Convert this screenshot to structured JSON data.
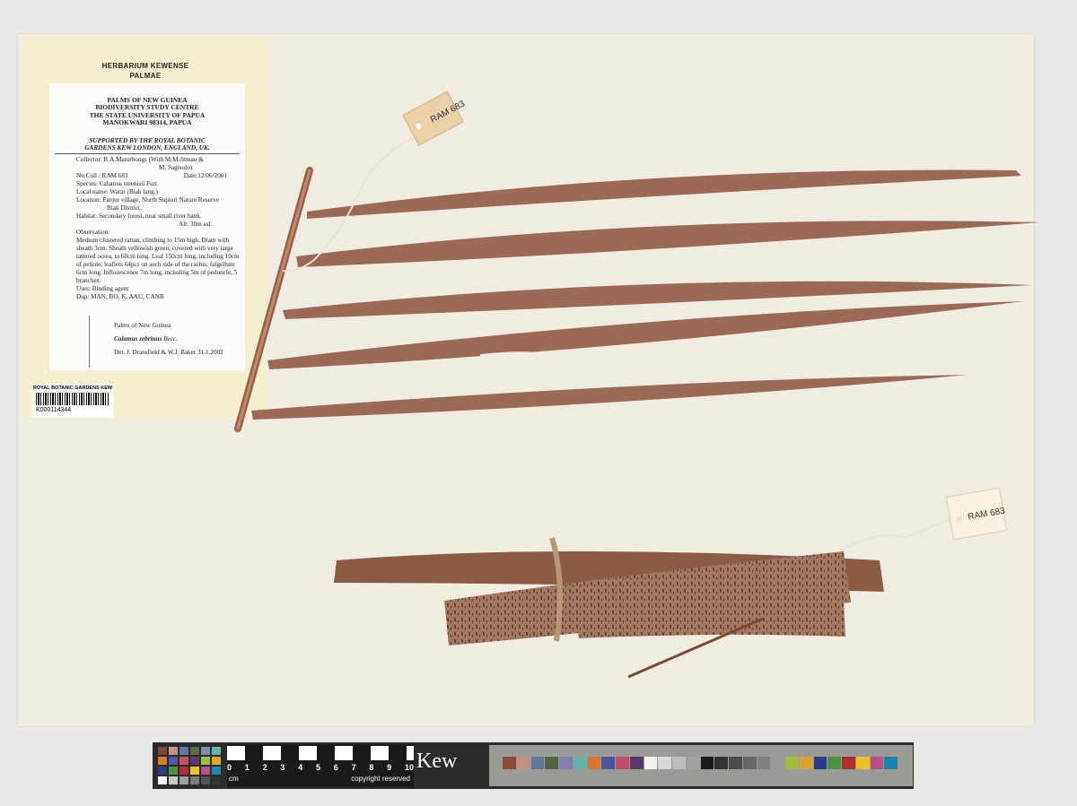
{
  "herbarium": {
    "line1": "HERBARIUM KEWENSE",
    "line2": "PALMAE"
  },
  "label": {
    "header": [
      "PALMS OF NEW GUINEA",
      "BIODIVERSITY STUDY CENTRE",
      "THE STATE UNIVERSITY OF PAPUA",
      "MANOKWARI 98314, PAPUA"
    ],
    "support": [
      "SUPPORTED BY THE ROYAL BOTANIC",
      "GARDENS KEW LONDON, ENGLAND, UK."
    ],
    "collector": "Collector: R.A.Maturbongs (With  M.M.Jitmau &",
    "collector2": "M. Sagisolo)",
    "number": "No.Coll : RAM 683",
    "date": "Date:12/06/2001",
    "species": "Species:  Calamus steenisii Furt.",
    "local_name": "Local name: Warar (Biak lang.)",
    "location": "Location: Fanjur village, North Supiori Nature Reserve",
    "location2": "Biak District.",
    "habitat": "Habitat: Secondary forest, near small river bank.",
    "altitude": "Alt: 30m asl.",
    "observation_head": "Observation:",
    "observation": "Medium clustered rattan, climbing to 15m high. Diam with sheath 3cm.  Sheath yellowish green, covered with very large tattered ocrea, to 60cm long. Leaf 150cm long, including 10cm of petiole; leaflets 64pcs on aech side of the rachis; falgellum 6cm long. Inflorescence 7m long, including 5m of peduncle, 5 branches.",
    "uses": "Uses:  Binding agent",
    "dup": "Dup: MAN, BO, K, AAU, CANB"
  },
  "determination": {
    "line1": "Palms of New Guinea",
    "taxon": "Calamus zebrinus",
    "author": "Becc.",
    "det": "Det. J. Dransfield & W.J. Baker    31.1.2002"
  },
  "barcode": {
    "header": "ROYAL BOTANIC GARDENS KEW",
    "number": "K000114344"
  },
  "tags": {
    "tag1": "RAM 683",
    "tag2": "RAM 683"
  },
  "ruler": {
    "numbers": [
      "0",
      "1",
      "2",
      "3",
      "4",
      "5",
      "6",
      "7",
      "8",
      "9",
      "10"
    ],
    "unit": "cm",
    "copyright": "copyright reserved",
    "logo": "Kew"
  },
  "colors": {
    "sheet": "#f1ece1",
    "leaf": "#9a6a55",
    "label_bg": "#fdfcf9",
    "kew_head": "#f4efcf"
  }
}
